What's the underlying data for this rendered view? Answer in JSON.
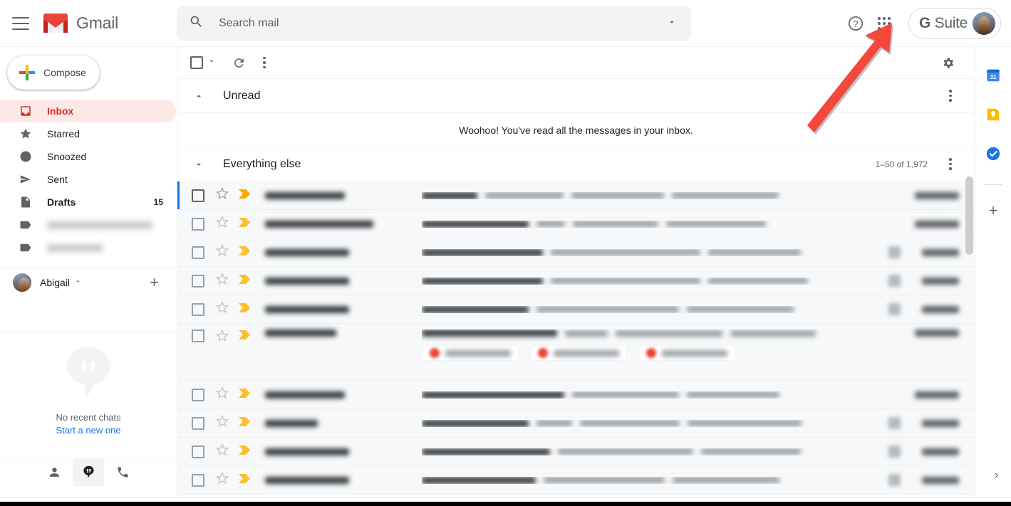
{
  "app": {
    "title": "Gmail",
    "brand_red": "#d93025",
    "accent_blue": "#1a73e8"
  },
  "topbar": {
    "menu_icon": "hamburger-icon",
    "logo_text": "Gmail",
    "search": {
      "placeholder": "Search mail",
      "value": "",
      "icon": "search-icon",
      "options_icon": "chevron-down-icon"
    },
    "help_icon": "help-circle-icon",
    "apps_icon": "apps-grid-icon",
    "gsuite": {
      "g": "G",
      "label": "Suite",
      "avatar": "user-avatar"
    }
  },
  "sidebar": {
    "compose": {
      "label": "Compose",
      "icon": "plus-icon"
    },
    "items": [
      {
        "label": "Inbox",
        "icon": "inbox-icon",
        "active": true,
        "bold": true,
        "count": ""
      },
      {
        "label": "Starred",
        "icon": "star-icon",
        "active": false,
        "bold": false,
        "count": ""
      },
      {
        "label": "Snoozed",
        "icon": "clock-icon",
        "active": false,
        "bold": false,
        "count": ""
      },
      {
        "label": "Sent",
        "icon": "send-icon",
        "active": false,
        "bold": false,
        "count": ""
      },
      {
        "label": "Drafts",
        "icon": "draft-icon",
        "active": false,
        "bold": true,
        "count": "15"
      },
      {
        "label": "",
        "icon": "label-icon",
        "active": false,
        "bold": false,
        "count": "",
        "redacted": true
      },
      {
        "label": "",
        "icon": "label-icon",
        "active": false,
        "bold": false,
        "count": "",
        "redacted": true
      }
    ],
    "account": {
      "name": "Abigail",
      "caret_icon": "chevron-down-icon",
      "add_icon": "plus-icon"
    },
    "chat": {
      "empty_icon": "hangouts-bubble-icon",
      "empty_text": "No recent chats",
      "new_link": "Start a new one",
      "tabs": [
        {
          "icon": "contacts-person-icon",
          "selected": false
        },
        {
          "icon": "hangouts-icon",
          "selected": true
        },
        {
          "icon": "phone-icon",
          "selected": false
        }
      ]
    }
  },
  "mail": {
    "toolbar": {
      "select_all_icon": "checkbox-icon",
      "select_caret_icon": "chevron-down-icon",
      "refresh_icon": "refresh-icon",
      "more_icon": "kebab-menu-icon",
      "settings_icon": "gear-icon"
    },
    "sections": [
      {
        "title": "Unread",
        "collapse_icon": "chevron-up-icon",
        "more_icon": "kebab-menu-icon",
        "count": "",
        "empty_message": "Woohoo! You've read all the messages in your inbox."
      },
      {
        "title": "Everything else",
        "collapse_icon": "chevron-up-icon",
        "more_icon": "kebab-menu-icon",
        "count": "1–50 of 1,972",
        "empty_message": ""
      }
    ],
    "rows": [
      {
        "sender": "",
        "subject": "",
        "time": "",
        "important": true,
        "starred": false,
        "attachment": false,
        "redacted": true,
        "first": true,
        "chips": 0
      },
      {
        "sender": "",
        "subject": "",
        "time": "",
        "important": true,
        "starred": false,
        "attachment": false,
        "redacted": true,
        "first": false,
        "chips": 0
      },
      {
        "sender": "",
        "subject": "",
        "time": "",
        "important": true,
        "starred": false,
        "attachment": true,
        "redacted": true,
        "first": false,
        "chips": 0
      },
      {
        "sender": "",
        "subject": "",
        "time": "",
        "important": true,
        "starred": false,
        "attachment": true,
        "redacted": true,
        "first": false,
        "chips": 0
      },
      {
        "sender": "",
        "subject": "",
        "time": "",
        "important": true,
        "starred": false,
        "attachment": true,
        "redacted": true,
        "first": false,
        "chips": 0
      },
      {
        "sender": "",
        "subject": "",
        "time": "",
        "important": true,
        "starred": false,
        "attachment": false,
        "redacted": true,
        "first": false,
        "chips": 3
      },
      {
        "sender": "",
        "subject": "",
        "time": "",
        "important": true,
        "starred": false,
        "attachment": false,
        "redacted": true,
        "first": false,
        "chips": 0
      },
      {
        "sender": "",
        "subject": "",
        "time": "",
        "important": true,
        "starred": false,
        "attachment": true,
        "redacted": true,
        "first": false,
        "chips": 0
      },
      {
        "sender": "",
        "subject": "",
        "time": "",
        "important": true,
        "starred": false,
        "attachment": true,
        "redacted": true,
        "first": false,
        "chips": 0
      },
      {
        "sender": "",
        "subject": "",
        "time": "",
        "important": true,
        "starred": false,
        "attachment": true,
        "redacted": true,
        "first": false,
        "chips": 0
      }
    ]
  },
  "rail": {
    "items": [
      {
        "icon": "google-calendar-icon",
        "label": "31"
      },
      {
        "icon": "google-keep-icon",
        "label": ""
      },
      {
        "icon": "google-tasks-icon",
        "label": ""
      }
    ],
    "add_icon": "plus-icon",
    "expand_icon": "chevron-right-icon"
  },
  "annotation": {
    "type": "arrow",
    "color": "#f4483c",
    "points_to": "apps-grid-icon"
  }
}
